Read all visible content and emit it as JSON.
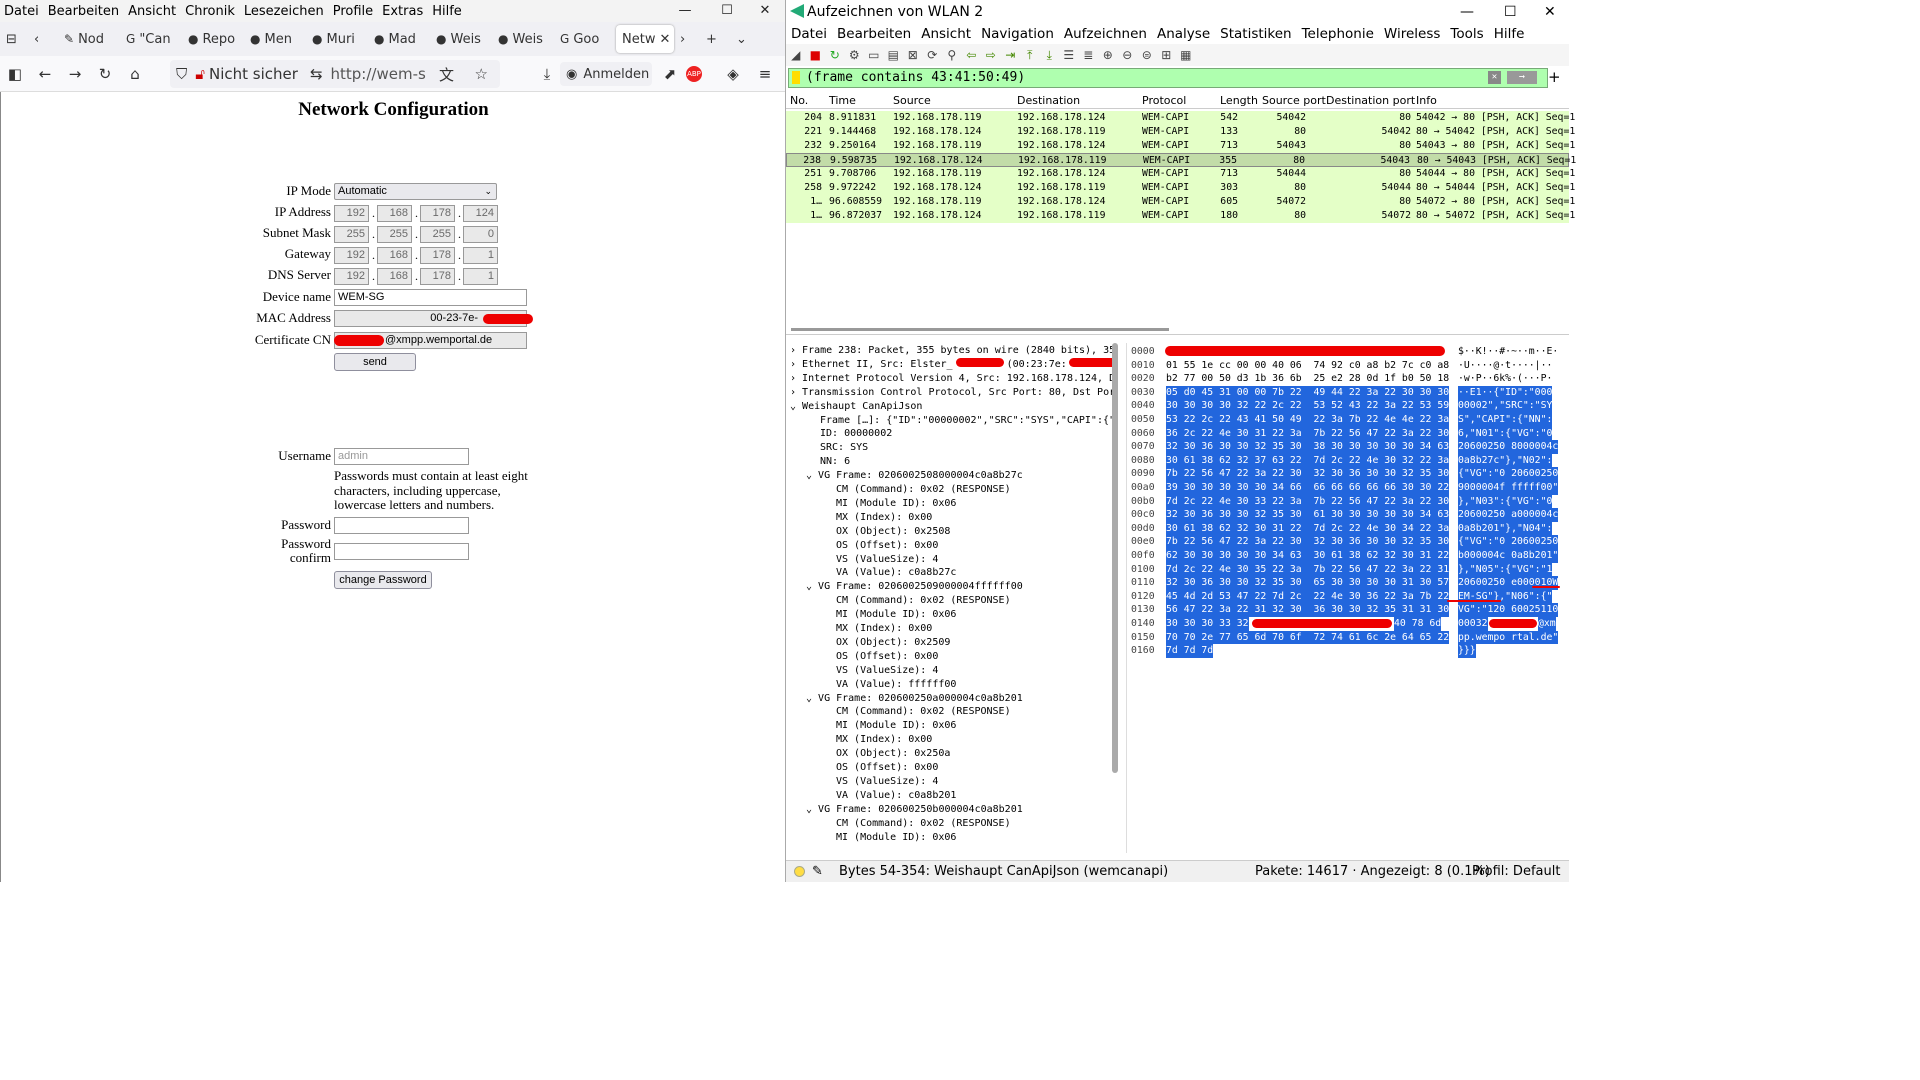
{
  "firefox": {
    "menu": [
      "Datei",
      "Bearbeiten",
      "Ansicht",
      "Chronik",
      "Lesezeichen",
      "Profile",
      "Extras",
      "Hilfe"
    ],
    "tabs": [
      "Nod",
      "\"Can",
      "Repo",
      "Men",
      "Muri",
      "Mad",
      "Weis",
      "Weis",
      "Goo"
    ],
    "active_tab": "Netw",
    "security_label": "Nicht sicher",
    "url": "http://wem-s",
    "signin_label": "Anmelden",
    "page": {
      "title": "Network Configuration",
      "ip_mode_label": "IP Mode",
      "ip_mode_value": "Automatic",
      "ip_label": "IP Address",
      "ip": [
        "192",
        "168",
        "178",
        "124"
      ],
      "mask_label": "Subnet Mask",
      "mask": [
        "255",
        "255",
        "255",
        "0"
      ],
      "gw_label": "Gateway",
      "gw": [
        "192",
        "168",
        "178",
        "1"
      ],
      "dns_label": "DNS Server",
      "dns": [
        "192",
        "168",
        "178",
        "1"
      ],
      "device_label": "Device name",
      "device_value": "WEM-SG",
      "mac_label": "MAC Address",
      "mac_value": "00-23-7e-",
      "cert_label": "Certificate CN",
      "cert_value": "@xmpp.wemportal.de",
      "send_label": "send",
      "user_label": "Username",
      "user_placeholder": "admin",
      "pw_hint": [
        "Passwords must contain at least eight",
        "characters, including uppercase,",
        "lowercase letters and numbers."
      ],
      "pw_label": "Password",
      "pwc_label1": "Password",
      "pwc_label2": "confirm",
      "change_label": "change Password"
    }
  },
  "wireshark": {
    "title": "Aufzeichnen von WLAN 2",
    "menu": [
      "Datei",
      "Bearbeiten",
      "Ansicht",
      "Navigation",
      "Aufzeichnen",
      "Analyse",
      "Statistiken",
      "Telephonie",
      "Wireless",
      "Tools",
      "Hilfe"
    ],
    "filter": "(frame contains 43:41:50:49)",
    "columns": [
      "No.",
      "Time",
      "Source",
      "Destination",
      "Protocol",
      "Length",
      "Source port",
      "Destination port",
      "Info"
    ],
    "packets": [
      [
        "204",
        "8.911831",
        "192.168.178.119",
        "192.168.178.124",
        "WEM-CAPI",
        "542",
        "54042",
        "80",
        "54042 → 80 [PSH, ACK] Seq=1"
      ],
      [
        "221",
        "9.144468",
        "192.168.178.124",
        "192.168.178.119",
        "WEM-CAPI",
        "133",
        "80",
        "54042",
        "80 → 54042 [PSH, ACK] Seq=1"
      ],
      [
        "232",
        "9.250164",
        "192.168.178.119",
        "192.168.178.124",
        "WEM-CAPI",
        "713",
        "54043",
        "80",
        "54043 → 80 [PSH, ACK] Seq=1"
      ],
      [
        "238",
        "9.598735",
        "192.168.178.124",
        "192.168.178.119",
        "WEM-CAPI",
        "355",
        "80",
        "54043",
        "80 → 54043 [PSH, ACK] Seq=1"
      ],
      [
        "251",
        "9.708706",
        "192.168.178.119",
        "192.168.178.124",
        "WEM-CAPI",
        "713",
        "54044",
        "80",
        "54044 → 80 [PSH, ACK] Seq=1"
      ],
      [
        "258",
        "9.972242",
        "192.168.178.124",
        "192.168.178.119",
        "WEM-CAPI",
        "303",
        "80",
        "54044",
        "80 → 54044 [PSH, ACK] Seq=1"
      ],
      [
        "1…",
        "96.608559",
        "192.168.178.119",
        "192.168.178.124",
        "WEM-CAPI",
        "605",
        "54072",
        "80",
        "54072 → 80 [PSH, ACK] Seq=1"
      ],
      [
        "1…",
        "96.872037",
        "192.168.178.124",
        "192.168.178.119",
        "WEM-CAPI",
        "180",
        "80",
        "54072",
        "80 → 54072 [PSH, ACK] Seq=1"
      ]
    ],
    "tree": [
      [
        "c",
        "Frame 238: Packet, 355 bytes on wire (2840 bits), 355"
      ],
      [
        "c",
        "Ethernet II, Src: Elster_"
      ],
      [
        "c",
        "Internet Protocol Version 4, Src: 192.168.178.124, Ds"
      ],
      [
        "c",
        "Transmission Control Protocol, Src Port: 80, Dst Port"
      ],
      [
        "o",
        "Weishaupt CanApiJson"
      ],
      [
        "1",
        "Frame […]: {\"ID\":\"00000002\",\"SRC\":\"SYS\",\"CAPI\":{\"N"
      ],
      [
        "1",
        "ID: 00000002"
      ],
      [
        "1",
        "SRC: SYS"
      ],
      [
        "1",
        "NN: 6"
      ],
      [
        "v",
        "VG Frame: 0206002508000004c0a8b27c"
      ],
      [
        "2",
        "CM (Command): 0x02 (RESPONSE)"
      ],
      [
        "2",
        "MI (Module ID): 0x06"
      ],
      [
        "2",
        "MX (Index): 0x00"
      ],
      [
        "2",
        "OX (Object): 0x2508"
      ],
      [
        "2",
        "OS (Offset): 0x00"
      ],
      [
        "2",
        "VS (ValueSize): 4"
      ],
      [
        "2",
        "VA (Value): c0a8b27c"
      ],
      [
        "v",
        "VG Frame: 0206002509000004ffffff00"
      ],
      [
        "2",
        "CM (Command): 0x02 (RESPONSE)"
      ],
      [
        "2",
        "MI (Module ID): 0x06"
      ],
      [
        "2",
        "MX (Index): 0x00"
      ],
      [
        "2",
        "OX (Object): 0x2509"
      ],
      [
        "2",
        "OS (Offset): 0x00"
      ],
      [
        "2",
        "VS (ValueSize): 4"
      ],
      [
        "2",
        "VA (Value): ffffff00"
      ],
      [
        "v",
        "VG Frame: 020600250a000004c0a8b201"
      ],
      [
        "2",
        "CM (Command): 0x02 (RESPONSE)"
      ],
      [
        "2",
        "MI (Module ID): 0x06"
      ],
      [
        "2",
        "MX (Index): 0x00"
      ],
      [
        "2",
        "OX (Object): 0x250a"
      ],
      [
        "2",
        "OS (Offset): 0x00"
      ],
      [
        "2",
        "VS (ValueSize): 4"
      ],
      [
        "2",
        "VA (Value): c0a8b201"
      ],
      [
        "v",
        "VG Frame: 020600250b000004c0a8b201"
      ],
      [
        "2",
        "CM (Command): 0x02 (RESPONSE)"
      ],
      [
        "2",
        "MI (Module ID): 0x06"
      ]
    ],
    "ethernet_mac": "(00:23:7e:",
    "hex_offsets": [
      "0000",
      "0010",
      "0020",
      "0030",
      "0040",
      "0050",
      "0060",
      "0070",
      "0080",
      "0090",
      "00a0",
      "00b0",
      "00c0",
      "00d0",
      "00e0",
      "00f0",
      "0100",
      "0110",
      "0120",
      "0130",
      "0140",
      "0150",
      "0160"
    ],
    "hex_bytes": [
      "",
      "01 55 1e cc 00 00 40 06  74 92 c0 a8 b2 7c c0 a8",
      "b2 77 00 50 d3 1b 36 6b  25 e2 28 0d 1f b0 50 18",
      "05 d0 45 31 00 00 7b 22  49 44 22 3a 22 30 30 30",
      "30 30 30 30 32 22 2c 22  53 52 43 22 3a 22 53 59",
      "53 22 2c 22 43 41 50 49  22 3a 7b 22 4e 4e 22 3a",
      "36 2c 22 4e 30 31 22 3a  7b 22 56 47 22 3a 22 30",
      "32 30 36 30 30 32 35 30  38 30 30 30 30 30 34 63",
      "30 61 38 62 32 37 63 22  7d 2c 22 4e 30 32 22 3a",
      "7b 22 56 47 22 3a 22 30  32 30 36 30 30 32 35 30",
      "39 30 30 30 30 30 34 66  66 66 66 66 66 30 30 22",
      "7d 2c 22 4e 30 33 22 3a  7b 22 56 47 22 3a 22 30",
      "32 30 36 30 30 32 35 30  61 30 30 30 30 30 34 63",
      "30 61 38 62 32 30 31 22  7d 2c 22 4e 30 34 22 3a",
      "7b 22 56 47 22 3a 22 30  32 30 36 30 30 32 35 30",
      "62 30 30 30 30 30 34 63  30 61 38 62 32 30 31 22",
      "7d 2c 22 4e 30 35 22 3a  7b 22 56 47 22 3a 22 31",
      "32 30 36 30 30 32 35 30  65 30 30 30 30 31 30 57",
      "45 4d 2d 53 47 22 7d 2c  22 4e 30 36 22 3a 7b 22",
      "56 47 22 3a 22 31 32 30  36 30 30 32 35 31 31 30",
      "30 30 30 33 32",
      "70 70 2e 77 65 6d 70 6f  72 74 61 6c 2e 64 65 22",
      "7d 7d 7d"
    ],
    "hex_ascii": [
      "$··K!··#·~··m··E·",
      "·U····@·t····|··",
      "·w·P··6k%·(···P·",
      "··E1··{\"ID\":\"000",
      "00002\",\"SRC\":\"SY",
      "S\",\"CAPI\":{\"NN\":",
      "6,\"N01\":{\"VG\":\"0",
      "20600250 8000004c",
      "0a8b27c\"},\"N02\":",
      "{\"VG\":\"0 20600250",
      "9000004f fffff00\"",
      "},\"N03\":{\"VG\":\"0",
      "20600250 a000004c",
      "0a8b201\"},\"N04\":",
      "{\"VG\":\"0 20600250",
      "b000004c 0a8b201\"",
      "},\"N05\":{\"VG\":\"1",
      "20600250 e000010W",
      "EM-SG\"},\"N06\":{\"",
      "VG\":\"120 60025110",
      "00032",
      "pp.wempo rtal.de\"",
      "}}}"
    ],
    "hex_tail_0140": "40 78 6d",
    "ascii_tail_0140": "@xm",
    "status_bytes": "Bytes 54-354: Weishaupt CanApiJson (wemcanapi)",
    "status_packets": "Pakete: 14617 · Angezeigt: 8 (0.1%)",
    "status_profile": "Profil: Default"
  }
}
